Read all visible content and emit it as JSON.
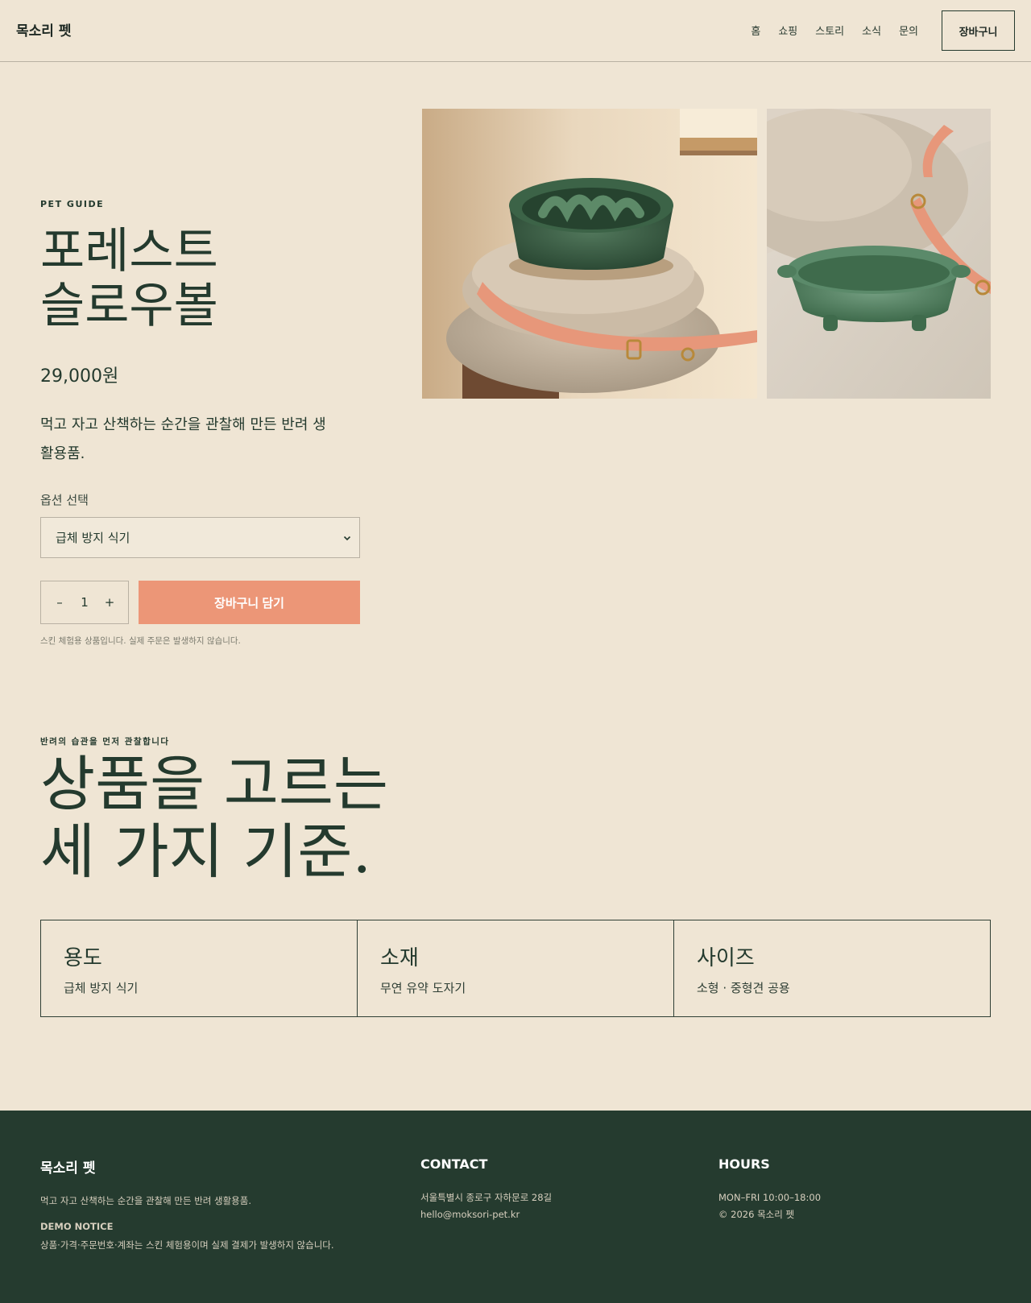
{
  "header": {
    "brand": "목소리 펫",
    "nav": [
      "홈",
      "쇼핑",
      "스토리",
      "소식",
      "문의"
    ],
    "cart_label": "장바구니"
  },
  "product": {
    "eyebrow": "PET GUIDE",
    "title_line1": "포레스트",
    "title_line2": "슬로우볼",
    "price": "29,000원",
    "description": "먹고 자고 산책하는 순간을 관찰해 만든 반려 생활용품.",
    "option_label": "옵션 선택",
    "option_selected": "급체 방지 식기",
    "quantity": "1",
    "minus": "–",
    "plus": "+",
    "add_to_cart": "장바구니 담기",
    "note": "스킨 체험용 상품입니다. 실제 주문은 발생하지 않습니다."
  },
  "criteria": {
    "eyebrow": "반려의 습관을 먼저 관찰합니다",
    "title_line1": "상품을 고르는",
    "title_line2": "세 가지 기준.",
    "cards": [
      {
        "title": "용도",
        "text": "급체 방지 식기"
      },
      {
        "title": "소재",
        "text": "무연 유약 도자기"
      },
      {
        "title": "사이즈",
        "text": "소형 · 중형견 공용"
      }
    ]
  },
  "footer": {
    "brand": "목소리 펫",
    "description": "먹고 자고 산책하는 순간을 관찰해 만든 반려 생활용품.",
    "notice_heading": "DEMO NOTICE",
    "notice_text": "상품·가격·주문번호·계좌는 스킨 체험용이며 실제 결제가 발생하지 않습니다.",
    "contact_heading": "CONTACT",
    "address": "서울특별시 종로구 자하문로 28길",
    "email": "hello@moksori-pet.kr",
    "hours_heading": "HOURS",
    "hours": "MON–FRI 10:00–18:00",
    "copyright": "© 2026 목소리 펫"
  },
  "colors": {
    "background": "#efe5d4",
    "text_green": "#243a2e",
    "accent_coral": "#ec9677",
    "footer_green": "#253b2f"
  }
}
